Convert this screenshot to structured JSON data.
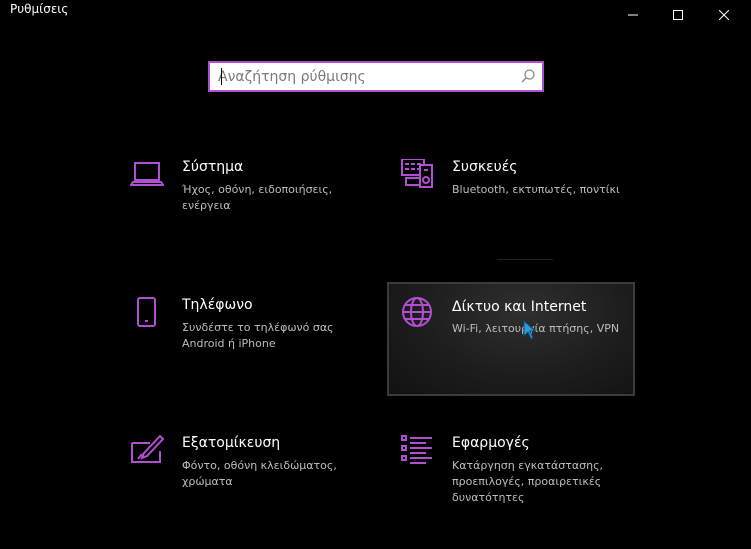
{
  "window": {
    "title": "Ρυθμίσεις",
    "controls": {
      "minimize": "minimize-icon",
      "maximize": "maximize-icon",
      "close": "close-icon"
    }
  },
  "search": {
    "placeholder": "Αναζήτηση ρύθμισης",
    "value": "",
    "icon": "search-icon"
  },
  "accent_color": "#b14fd3",
  "categories": [
    {
      "title": "Σύστημα",
      "description": "Ήχος, οθόνη, ειδοποιήσεις, ενέργεια",
      "icon": "laptop-icon"
    },
    {
      "title": "Συσκευές",
      "description": "Bluetooth, εκτυπωτές, ποντίκι",
      "icon": "devices-icon"
    },
    {
      "title": "Τηλέφωνο",
      "description": "Συνδέστε το τηλέφωνό σας Android ή iPhone",
      "icon": "phone-icon"
    },
    {
      "title": "Δίκτυο και Internet",
      "description": "Wi-Fi, λειτουργία πτήσης, VPN",
      "icon": "globe-icon",
      "hovered": true
    },
    {
      "title": "Εξατομίκευση",
      "description": "Φόντο, οθόνη κλειδώματος, χρώματα",
      "icon": "personalization-icon"
    },
    {
      "title": "Εφαρμογές",
      "description": "Κατάργηση εγκατάστασης, προεπιλογές, προαιρετικές δυνατότητες",
      "icon": "apps-icon"
    }
  ]
}
